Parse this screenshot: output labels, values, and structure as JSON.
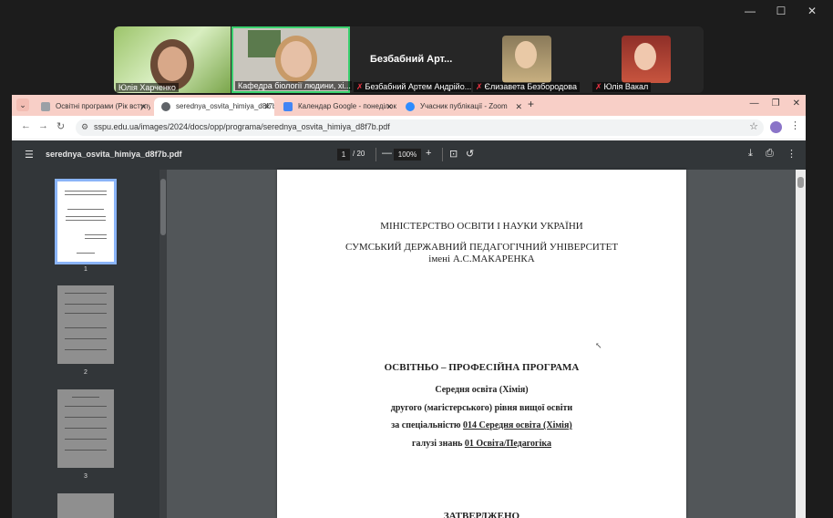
{
  "zoom": {
    "window_controls": [
      "—",
      "☐",
      "✕"
    ],
    "participants": [
      {
        "name": "Юлія Харченко",
        "muted": false
      },
      {
        "name": "Кафедра біології людини, хі...",
        "muted": false
      },
      {
        "name": "Безбабний Артем Андрійо...",
        "muted": true,
        "display_name": "Безбабний Арт..."
      },
      {
        "name": "Єлизавета Безбородова",
        "muted": true
      },
      {
        "name": "Юлія Вакал",
        "muted": true
      }
    ]
  },
  "browser": {
    "tabs": [
      {
        "label": "Освітні програми (Рік вступу 2",
        "active": false
      },
      {
        "label": "serednya_osvita_himiya_d8f7b.p",
        "active": true
      },
      {
        "label": "Календар Google - понеділок",
        "active": false
      },
      {
        "label": "Учасник публікації - Zoom",
        "active": false
      }
    ],
    "new_tab": "+",
    "url": "sspu.edu.ua/images/2024/docs/opp/programa/serednya_osvita_himiya_d8f7b.pdf"
  },
  "pdf": {
    "filename": "serednya_osvita_himiya_d8f7b.pdf",
    "current_page": "1",
    "total_pages": "/ 20",
    "zoom": "100%",
    "thumbnails": [
      "1",
      "2",
      "3"
    ],
    "page": {
      "ministry": "МІНІСТЕРСТВО ОСВІТИ І НАУКИ УКРАЇНИ",
      "university": "СУМСЬКИЙ ДЕРЖАВНИЙ ПЕДАГОГІЧНИЙ УНІВЕРСИТЕТ",
      "university_name": "імені А.С.МАКАРЕНКА",
      "program_title": "ОСВІТНЬО – ПРОФЕСІЙНА ПРОГРАМА",
      "program_name": "Середня освіта (Хімія)",
      "level": "другого (магістерського) рівня вищої освіти",
      "specialty_prefix": "за спеціальністю ",
      "specialty": "014 Середня освіта (Хімія)",
      "field_prefix": "галузі знань ",
      "field": "01 Освіта/Педагогіка",
      "approved": "ЗАТВЕРДЖЕНО"
    }
  }
}
